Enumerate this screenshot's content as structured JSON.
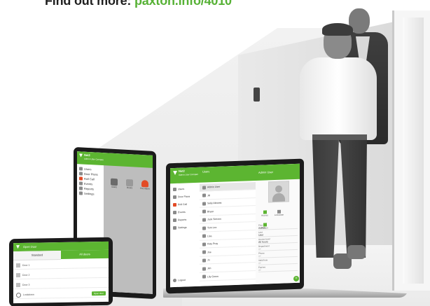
{
  "headline": {
    "prefix": "Find out more: ",
    "link": "paxton.info/4010"
  },
  "colors": {
    "brand_green": "#5cb531",
    "link_green": "#56b135"
  },
  "tablet": {
    "app_title": "Net2",
    "subtitle": "Admin User Company",
    "nav": [
      "Users",
      "Door Plans",
      "Roll Call",
      "Events",
      "Reports",
      "Settings"
    ],
    "tiles": [
      {
        "icon": "user-icon",
        "label": "Users"
      },
      {
        "icon": "door-icon",
        "label": "Doors"
      },
      {
        "icon": "flame-icon",
        "label": "Fire Alarm"
      }
    ]
  },
  "laptop": {
    "app_title": "Net2",
    "subtitle": "Admin User Company",
    "nav": [
      "Users",
      "Door Plans",
      "Roll Call",
      "Events",
      "Reports",
      "Settings"
    ],
    "logout": "Logout",
    "list_title": "Users",
    "list_rows": [
      "Admin User",
      "Jill",
      "Sally Abrams",
      "Bryan",
      "Jack Simons",
      "Tom Lee",
      "Lisa",
      "Katy Pray",
      "Joe",
      "Jo",
      "Jim",
      "Lily Green"
    ],
    "detail_title": "Admin User",
    "detail_icons": [
      {
        "icon": "key-icon",
        "label": "Access"
      },
      {
        "icon": "lock-icon",
        "label": "Lockdown"
      },
      {
        "icon": "person-icon",
        "label": "Person"
      }
    ],
    "detail_fields": [
      {
        "label": "First",
        "value": "Admin"
      },
      {
        "label": "Last",
        "value": "User"
      },
      {
        "label": "Access level",
        "value": "All hours"
      },
      {
        "label": "Department",
        "value": "—"
      },
      {
        "label": "Phone",
        "value": "—"
      },
      {
        "label": "Valid from",
        "value": "—"
      },
      {
        "label": "Expires",
        "value": "—"
      }
    ],
    "fab": "+"
  },
  "phone": {
    "title": "Open Door",
    "tabs": {
      "active": "Standard",
      "inactive": "All doors"
    },
    "rows": [
      "Door 1",
      "Door 2",
      "Door 3",
      "Lockdown"
    ],
    "button": "Open door"
  }
}
